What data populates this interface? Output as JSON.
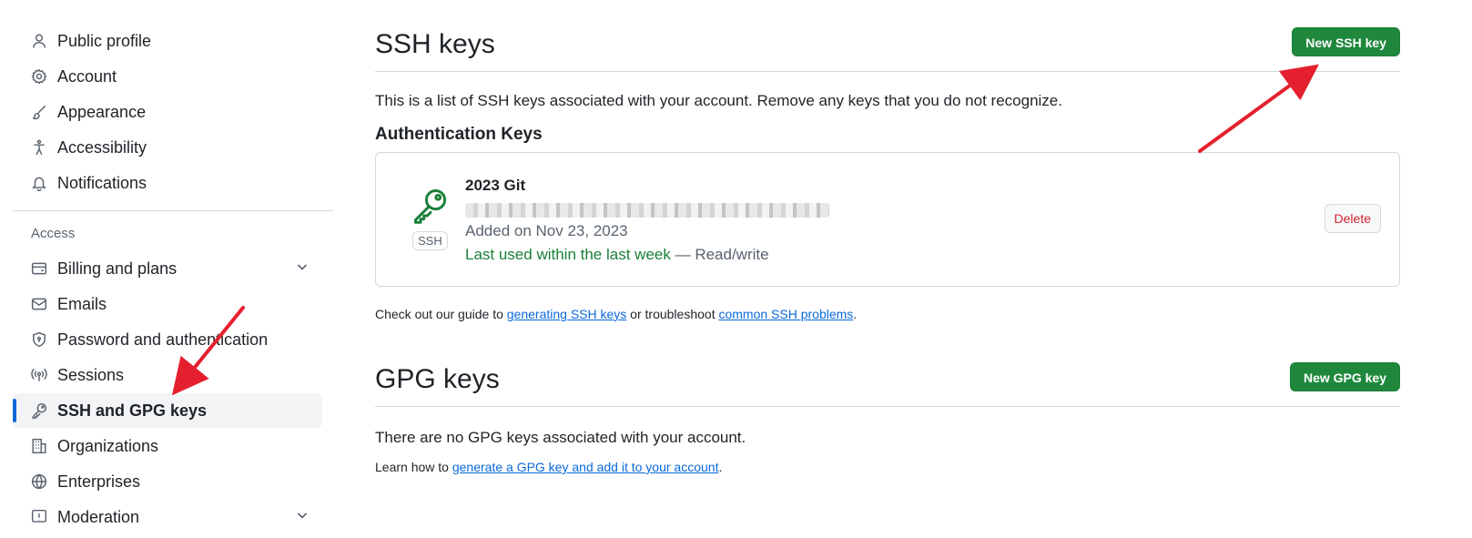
{
  "sidebar": {
    "top_items": [
      {
        "label": "Public profile",
        "icon": "person-icon"
      },
      {
        "label": "Account",
        "icon": "gear-icon"
      },
      {
        "label": "Appearance",
        "icon": "paintbrush-icon"
      },
      {
        "label": "Accessibility",
        "icon": "accessibility-icon"
      },
      {
        "label": "Notifications",
        "icon": "bell-icon"
      }
    ],
    "access_title": "Access",
    "access_items": [
      {
        "label": "Billing and plans",
        "icon": "credit-card-icon",
        "has_chevron": true
      },
      {
        "label": "Emails",
        "icon": "mail-icon"
      },
      {
        "label": "Password and authentication",
        "icon": "shield-lock-icon"
      },
      {
        "label": "Sessions",
        "icon": "broadcast-icon"
      },
      {
        "label": "SSH and GPG keys",
        "icon": "key-icon",
        "active": true
      },
      {
        "label": "Organizations",
        "icon": "organization-icon"
      },
      {
        "label": "Enterprises",
        "icon": "globe-icon"
      },
      {
        "label": "Moderation",
        "icon": "report-icon",
        "has_chevron": true
      }
    ]
  },
  "ssh": {
    "title": "SSH keys",
    "new_button": "New SSH key",
    "description": "This is a list of SSH keys associated with your account. Remove any keys that you do not recognize.",
    "subheading": "Authentication Keys",
    "key": {
      "badge": "SSH",
      "title": "2023 Git",
      "added": "Added on Nov 23, 2023",
      "last_used": "Last used within the last week",
      "access": "— Read/write",
      "delete_button": "Delete"
    },
    "guide": {
      "prefix": "Check out our guide to ",
      "link1": "generating SSH keys",
      "middle": " or troubleshoot ",
      "link2": "common SSH problems",
      "suffix": "."
    }
  },
  "gpg": {
    "title": "GPG keys",
    "new_button": "New GPG key",
    "none_text": "There are no GPG keys associated with your account.",
    "learn_prefix": "Learn how to ",
    "learn_link": "generate a GPG key and add it to your account",
    "learn_suffix": "."
  },
  "colors": {
    "primary_button": "#1f883d",
    "link": "#0969da",
    "active_indicator": "#0969da",
    "danger": "#d1242f",
    "annotation_arrow": "#e5202e"
  }
}
